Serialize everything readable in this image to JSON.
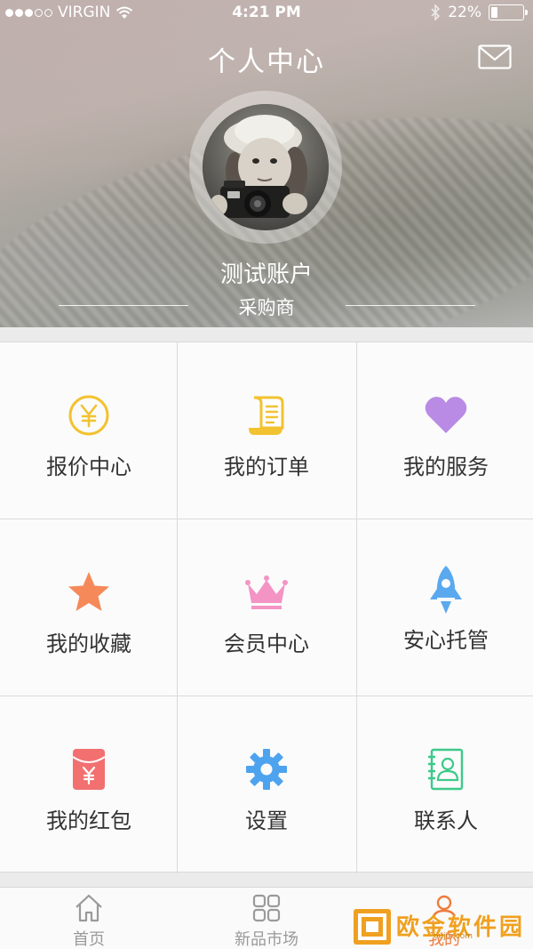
{
  "status_bar": {
    "carrier": "VIRGIN",
    "time": "4:21 PM",
    "battery_text": "22%",
    "battery_level": 0.22
  },
  "header": {
    "title": "个人中心",
    "mail_icon": "mail-icon"
  },
  "profile": {
    "name": "测试账户",
    "role": "采购商"
  },
  "menu": [
    {
      "label": "报价中心",
      "icon": "yen-coin-icon",
      "color": "#f2c230"
    },
    {
      "label": "我的订单",
      "icon": "receipt-icon",
      "color": "#f2c230"
    },
    {
      "label": "我的服务",
      "icon": "heart-icon",
      "color": "#b98be4"
    },
    {
      "label": "我的收藏",
      "icon": "star-icon",
      "color": "#f5895a"
    },
    {
      "label": "会员中心",
      "icon": "crown-icon",
      "color": "#f394c4"
    },
    {
      "label": "安心托管",
      "icon": "rocket-icon",
      "color": "#5aa9ee"
    },
    {
      "label": "我的红包",
      "icon": "red-envelope-icon",
      "color": "#f27070"
    },
    {
      "label": "设置",
      "icon": "gear-icon",
      "color": "#4ea3ee"
    },
    {
      "label": "联系人",
      "icon": "contacts-icon",
      "color": "#3cc98a"
    }
  ],
  "tabbar": [
    {
      "label": "首页",
      "icon": "home-icon"
    },
    {
      "label": "新品市场",
      "icon": "grid-icon"
    },
    {
      "label": "我的",
      "icon": "person-icon",
      "active": true
    }
  ],
  "watermark": {
    "text": "欧金软件园",
    "url": "oujin.com"
  }
}
